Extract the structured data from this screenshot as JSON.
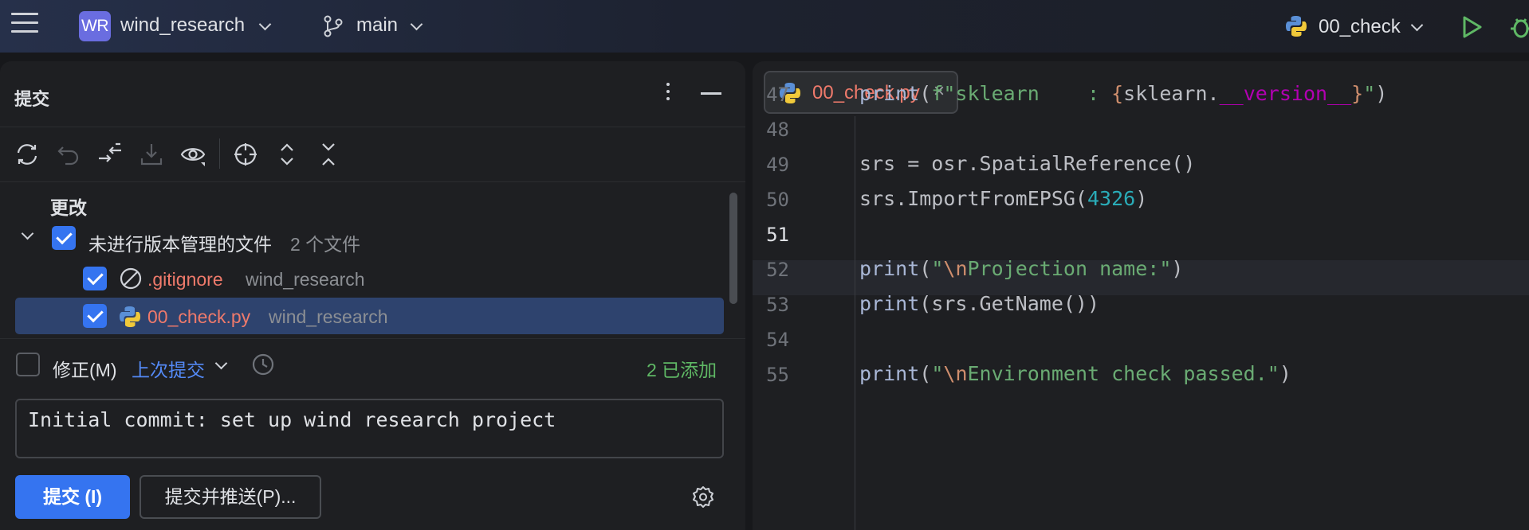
{
  "topbar": {
    "project_badge": "WR",
    "project_name": "wind_research",
    "branch": "main",
    "run_config": "00_check",
    "colors": {
      "badge": "#6a6de0",
      "run": "#5fb865"
    }
  },
  "commit_panel": {
    "title": "提交",
    "section_label": "更改",
    "group": {
      "label": "未进行版本管理的文件",
      "count": "2 个文件"
    },
    "files": [
      {
        "name": ".gitignore",
        "module": "wind_research",
        "icon": "ignored-icon",
        "checked": true
      },
      {
        "name": "00_check.py",
        "module": "wind_research",
        "icon": "python-icon",
        "checked": true,
        "selected": true
      }
    ],
    "amend_label": "修正(M)",
    "amend_link": "上次提交",
    "added_status": "2 已添加",
    "message": "Initial commit: set up wind research project",
    "commit_button": "提交 (I)",
    "commit_push_button": "提交并推送(P)...",
    "toolbar_icons": [
      "refresh-icon",
      "rollback-icon",
      "shelve-icon",
      "download-icon",
      "preview-icon",
      "target-icon",
      "expand-all-icon",
      "collapse-all-icon"
    ]
  },
  "editor": {
    "tab_label": "00_check.py",
    "tab_close": "×",
    "current_line": "51",
    "lines": [
      {
        "num": "47",
        "code": [
          {
            "t": "print",
            "c": "kw-fn"
          },
          {
            "t": "(",
            "c": ""
          },
          {
            "t": "f\"sklearn    : ",
            "c": "s-str"
          },
          {
            "t": "{",
            "c": "s-brace"
          },
          {
            "t": "sklearn.",
            "c": ""
          },
          {
            "t": "__version__",
            "c": "s-dunder"
          },
          {
            "t": "}",
            "c": "s-brace"
          },
          {
            "t": "\"",
            "c": "s-str"
          },
          {
            "t": ")",
            "c": ""
          }
        ]
      },
      {
        "num": "48",
        "code": []
      },
      {
        "num": "49",
        "code": [
          {
            "t": "srs = osr.SpatialReference()",
            "c": ""
          }
        ]
      },
      {
        "num": "50",
        "code": [
          {
            "t": "srs.ImportFromEPSG(",
            "c": ""
          },
          {
            "t": "4326",
            "c": "s-num"
          },
          {
            "t": ")",
            "c": ""
          }
        ]
      },
      {
        "num": "51",
        "code": []
      },
      {
        "num": "52",
        "code": [
          {
            "t": "print",
            "c": "kw-fn"
          },
          {
            "t": "(",
            "c": ""
          },
          {
            "t": "\"",
            "c": "s-str"
          },
          {
            "t": "\\n",
            "c": "s-esc"
          },
          {
            "t": "Projection name:\"",
            "c": "s-str"
          },
          {
            "t": ")",
            "c": ""
          }
        ]
      },
      {
        "num": "53",
        "code": [
          {
            "t": "print",
            "c": "kw-fn"
          },
          {
            "t": "(srs.GetName())",
            "c": ""
          }
        ]
      },
      {
        "num": "54",
        "code": []
      },
      {
        "num": "55",
        "code": [
          {
            "t": "print",
            "c": "kw-fn"
          },
          {
            "t": "(",
            "c": ""
          },
          {
            "t": "\"",
            "c": "s-str"
          },
          {
            "t": "\\n",
            "c": "s-esc"
          },
          {
            "t": "Environment check passed.\"",
            "c": "s-str"
          },
          {
            "t": ")",
            "c": ""
          }
        ]
      }
    ]
  }
}
